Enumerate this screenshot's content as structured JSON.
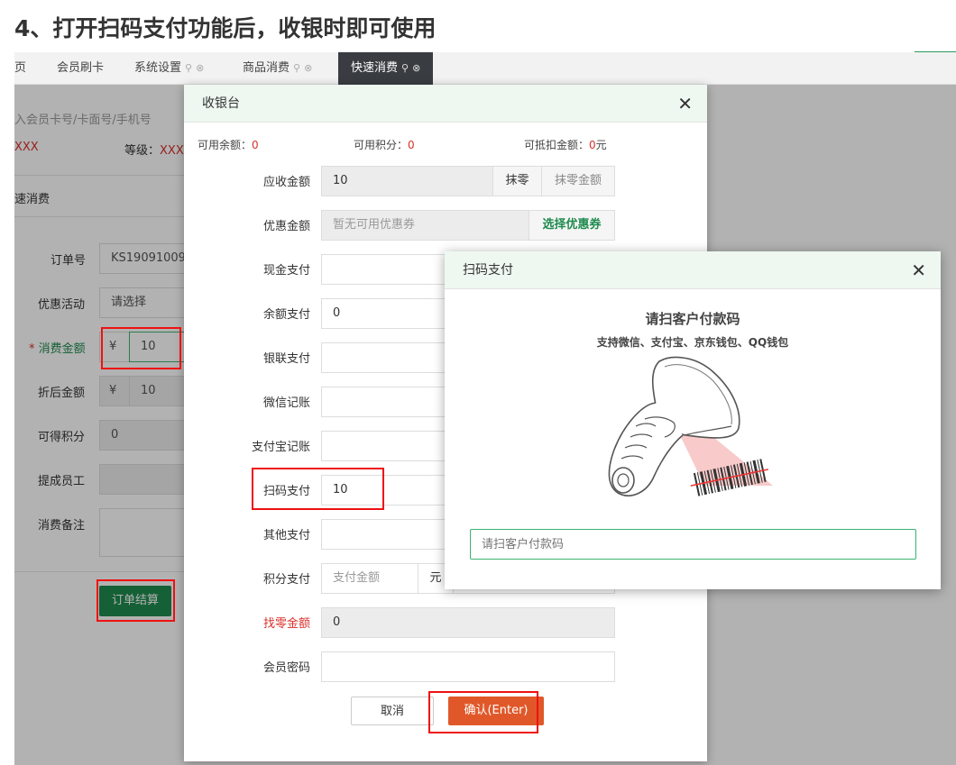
{
  "heading": "4、打开扫码支付功能后，收银时即可使用",
  "tabs": [
    {
      "label": "页"
    },
    {
      "label": "会员刷卡"
    },
    {
      "label": "系统设置"
    },
    {
      "label": "商品消费"
    },
    {
      "label": "快速消费"
    }
  ],
  "background": {
    "member_placeholder": "入会员卡号/卡面号/手机号",
    "member_name": "XXX",
    "level_label": "等级：",
    "level_value": "XXX",
    "section_title": "速消费",
    "order_no_label": "订单号",
    "order_no_value": "KS19091009",
    "promo_label": "优惠活动",
    "promo_value": "请选择",
    "amount_label": "消费金额",
    "amount_required": "*",
    "currency": "¥",
    "amount_value": "10",
    "discount_label": "折后金额",
    "discount_value": "10",
    "points_label": "可得积分",
    "points_value": "0",
    "staff_label": "提成员工",
    "remark_label": "消费备注",
    "checkout_button": "订单结算"
  },
  "cashier": {
    "title": "收银台",
    "balance_label": "可用余额：",
    "balance_value": "0",
    "points_label": "可用积分：",
    "points_value": "0",
    "deduct_label": "可抵扣金额：",
    "deduct_value": "0",
    "deduct_unit": "元",
    "receivable_label": "应收金额",
    "receivable_value": "10",
    "round_button": "抹零",
    "round_amount_button": "抹零金额",
    "discount_label": "优惠金额",
    "discount_placeholder": "暂无可用优惠券",
    "choose_coupon": "选择优惠券",
    "cash_label": "现金支付",
    "balance_pay_label": "余额支付",
    "balance_pay_value": "0",
    "unionpay_label": "银联支付",
    "wechat_label": "微信记账",
    "alipay_label": "支付宝记账",
    "scanpay_label": "扫码支付",
    "scanpay_value": "10",
    "other_label": "其他支付",
    "points_pay_label": "积分支付",
    "points_pay_placeholder": "支付金额",
    "points_pay_unit": "元",
    "change_label": "找零金额",
    "change_value": "0",
    "password_label": "会员密码",
    "cancel_button": "取消",
    "confirm_button": "确认(Enter)"
  },
  "scan_dialog": {
    "title": "扫码支付",
    "instruction": "请扫客户付款码",
    "supported": "支持微信、支付宝、京东钱包、QQ钱包",
    "input_placeholder": "请扫客户付款码"
  },
  "colors": {
    "accent_green": "#1f8a4e",
    "confirm_orange": "#e0582a",
    "highlight_red": "#e11",
    "header_tint": "#eef8f1"
  }
}
